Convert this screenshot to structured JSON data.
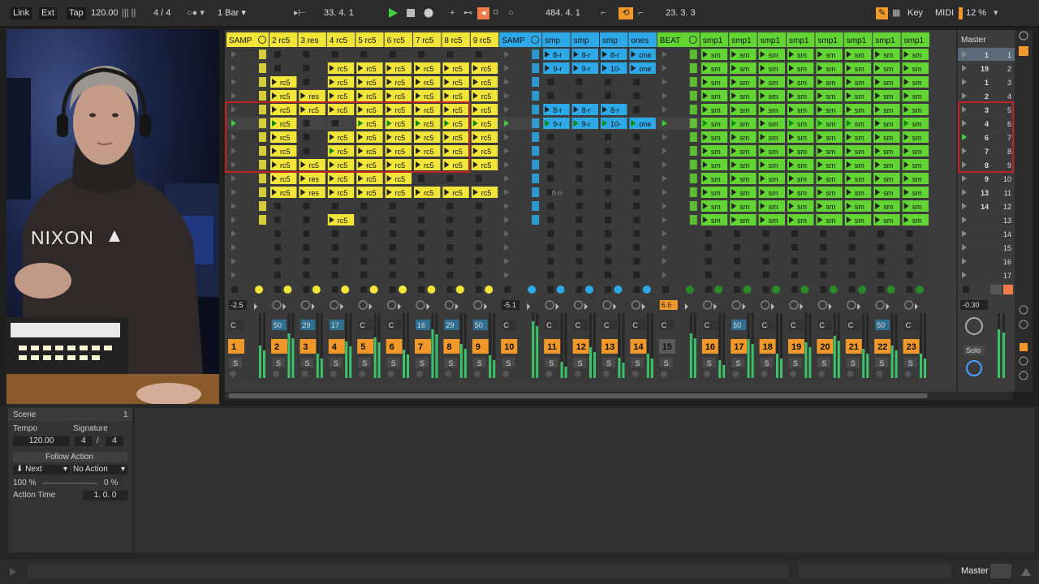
{
  "colors": {
    "yellow": "#f2e53a",
    "blue": "#2ea9e8",
    "green": "#62d534",
    "orange": "#f0982a",
    "red_highlight": "#c22222",
    "slot_bg": "#3a3a3a"
  },
  "transport": {
    "link": "Link",
    "ext": "Ext",
    "tap": "Tap",
    "tempo": "120.00",
    "signature": "4 / 4",
    "quantize": "1 Bar",
    "position": "33.   4.   1",
    "loop_start": "484.   4.   1",
    "loop_length": "23.   3.   3",
    "key": "Key",
    "midi": "MIDI",
    "cpu": "12 %"
  },
  "tracks": [
    {
      "name": "SAMP",
      "color": "yellow",
      "vol": "-2.5",
      "num": "1",
      "orange": true
    },
    {
      "name": "2 rc5",
      "color": "yellow",
      "vol": "",
      "num": "2",
      "orange": true
    },
    {
      "name": "3 res",
      "color": "yellow",
      "vol": "",
      "num": "3",
      "orange": true
    },
    {
      "name": "4 rc5",
      "color": "yellow",
      "vol": "",
      "num": "4",
      "orange": true
    },
    {
      "name": "5 rc5",
      "color": "yellow",
      "vol": "",
      "num": "5",
      "orange": true
    },
    {
      "name": "6 rc5",
      "color": "yellow",
      "vol": "",
      "num": "6",
      "orange": true
    },
    {
      "name": "7 rc5",
      "color": "yellow",
      "vol": "",
      "num": "7",
      "orange": true
    },
    {
      "name": "8 rc5",
      "color": "yellow",
      "vol": "",
      "num": "8",
      "orange": true
    },
    {
      "name": "9 rc5",
      "color": "yellow",
      "vol": "",
      "num": "9",
      "orange": true
    },
    {
      "name": "SAMP",
      "color": "blue",
      "vol": "-5.1",
      "num": "10",
      "orange": true
    },
    {
      "name": "smp",
      "color": "blue",
      "vol": "",
      "num": "11",
      "orange": true
    },
    {
      "name": "smp",
      "color": "blue",
      "vol": "",
      "num": "12",
      "orange": true
    },
    {
      "name": "smp",
      "color": "blue",
      "vol": "",
      "num": "13",
      "orange": true
    },
    {
      "name": "ones",
      "color": "blue",
      "vol": "",
      "num": "14",
      "orange": true
    },
    {
      "name": "BEAT",
      "color": "green",
      "vol": "6.6",
      "num": "15",
      "orange": false
    },
    {
      "name": "smp1",
      "color": "green",
      "vol": "",
      "num": "16",
      "orange": true
    },
    {
      "name": "smp1",
      "color": "green",
      "vol": "",
      "num": "17",
      "orange": true
    },
    {
      "name": "smp1",
      "color": "green",
      "vol": "",
      "num": "18",
      "orange": true
    },
    {
      "name": "smp1",
      "color": "green",
      "vol": "",
      "num": "19",
      "orange": true
    },
    {
      "name": "smp1",
      "color": "green",
      "vol": "",
      "num": "20",
      "orange": true
    },
    {
      "name": "smp1",
      "color": "green",
      "vol": "",
      "num": "21",
      "orange": true
    },
    {
      "name": "smp1",
      "color": "green",
      "vol": "",
      "num": "22",
      "orange": true
    },
    {
      "name": "smp1",
      "color": "green",
      "vol": "",
      "num": "23",
      "orange": true
    }
  ],
  "pan_values": [
    "C",
    "50",
    "29",
    "17",
    "C",
    "C",
    "16",
    "29",
    "50",
    "C",
    "C",
    "C",
    "C",
    "C",
    "C",
    "C",
    "50",
    "C",
    "C",
    "C",
    "C",
    "50",
    "C"
  ],
  "solo_label": "S",
  "master": {
    "title": "Master",
    "volume": "-0.30",
    "solo": "Solo",
    "scenes": [
      {
        "left": "1",
        "right": "1"
      },
      {
        "left": "19",
        "right": "2"
      },
      {
        "left": "1",
        "right": "3"
      },
      {
        "left": "2",
        "right": "4"
      },
      {
        "left": "3",
        "right": "5"
      },
      {
        "left": "4",
        "right": "6"
      },
      {
        "left": "6",
        "right": "7"
      },
      {
        "left": "7",
        "right": "8"
      },
      {
        "left": "8",
        "right": "9"
      },
      {
        "left": "9",
        "right": "10"
      },
      {
        "left": "13",
        "right": "11"
      },
      {
        "left": "14",
        "right": "12"
      },
      {
        "left": "",
        "right": "13"
      },
      {
        "left": "",
        "right": "14"
      },
      {
        "left": "",
        "right": "15"
      },
      {
        "left": "",
        "right": "16"
      },
      {
        "left": "",
        "right": "17"
      }
    ]
  },
  "clip_texts": {
    "yellow_a": "rc5",
    "yellow_b": "res",
    "blue_a": "8-r",
    "blue_b": "9-r",
    "blue_c": "10-",
    "blue_d": "sm",
    "blue_e": "one",
    "green_a": "sm",
    "empty_note": "8-n"
  },
  "webcam": {
    "shirt_text": "NIXON"
  },
  "scene_panel": {
    "title": "Scene",
    "number": "1",
    "tempo_label": "Tempo",
    "tempo_value": "120.00",
    "signature_label": "Signature",
    "sig_num": "4",
    "sig_sep": "/",
    "sig_den": "4",
    "follow_action": "Follow Action",
    "action_a": "Next",
    "action_b": "No Action",
    "chance_a": "100 %",
    "chance_b": "0 %",
    "action_time_label": "Action Time",
    "action_time_value": "1.   0.   0"
  },
  "status": {
    "master_label": "Master"
  }
}
